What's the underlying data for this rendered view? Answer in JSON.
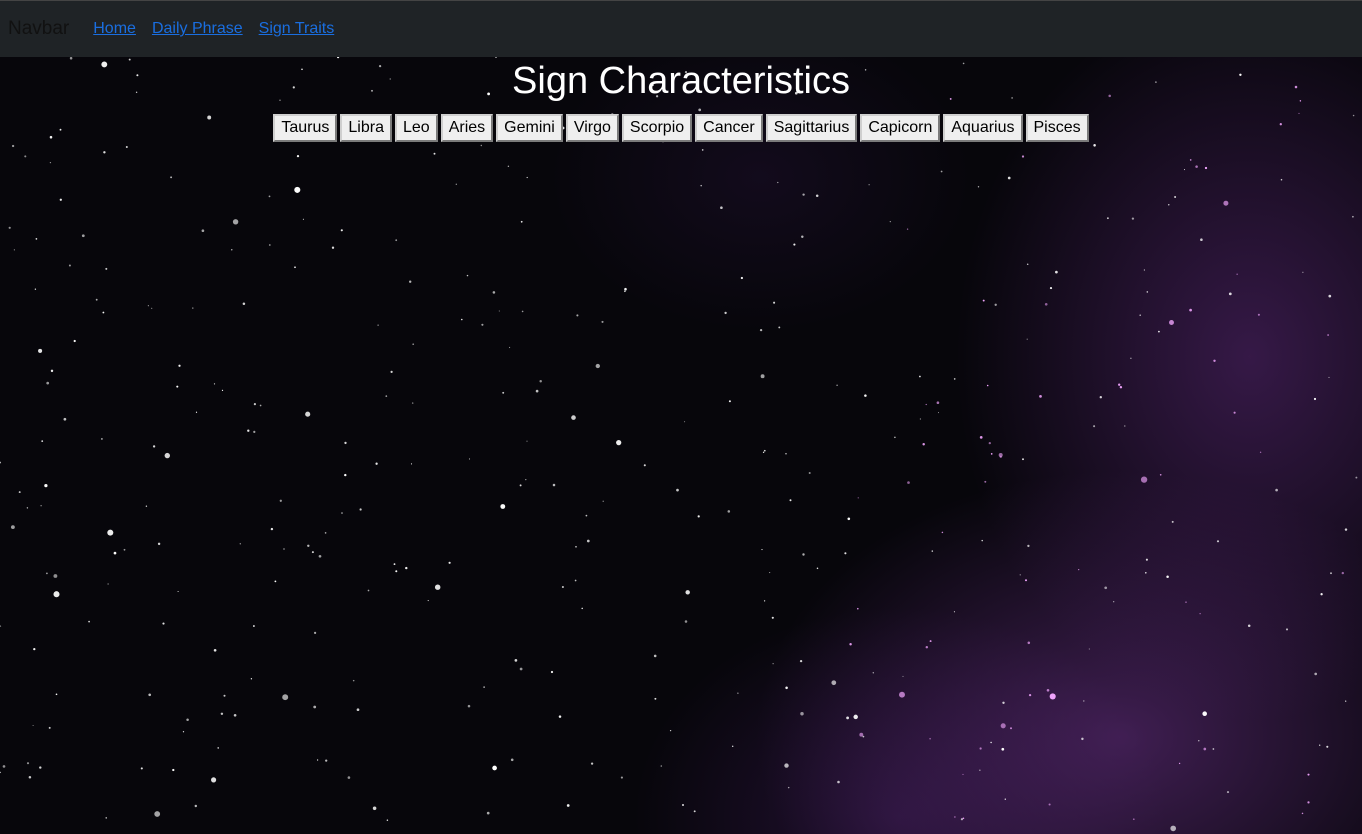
{
  "navbar": {
    "brand": "Navbar",
    "links": [
      "Home",
      "Daily Phrase",
      "Sign Traits"
    ]
  },
  "page": {
    "title": "Sign Characteristics"
  },
  "signs": [
    "Taurus",
    "Libra",
    "Leo",
    "Aries",
    "Gemini",
    "Virgo",
    "Scorpio",
    "Cancer",
    "Sagittarius",
    "Capicorn",
    "Aquarius",
    "Pisces"
  ],
  "colors": {
    "navbar_bg": "#1f2326",
    "link": "#1a6ee0",
    "space_bg": "#07060b",
    "nebula": "#6e328c"
  }
}
